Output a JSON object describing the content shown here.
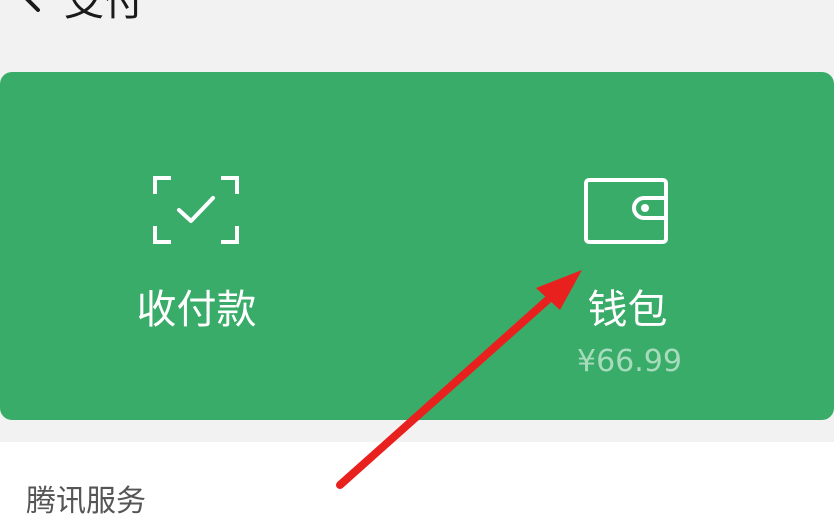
{
  "header": {
    "title": "支付",
    "back_icon": "chevron-left-icon"
  },
  "pay_card": {
    "background": "#3aac6a",
    "items": [
      {
        "label": "收付款",
        "icon": "scan-check-icon"
      },
      {
        "label": "钱包",
        "icon": "wallet-icon",
        "balance": "¥66.99"
      }
    ]
  },
  "services": {
    "title": "腾讯服务"
  },
  "annotation": {
    "type": "red-arrow",
    "target": "wallet",
    "color": "#e8201e"
  }
}
